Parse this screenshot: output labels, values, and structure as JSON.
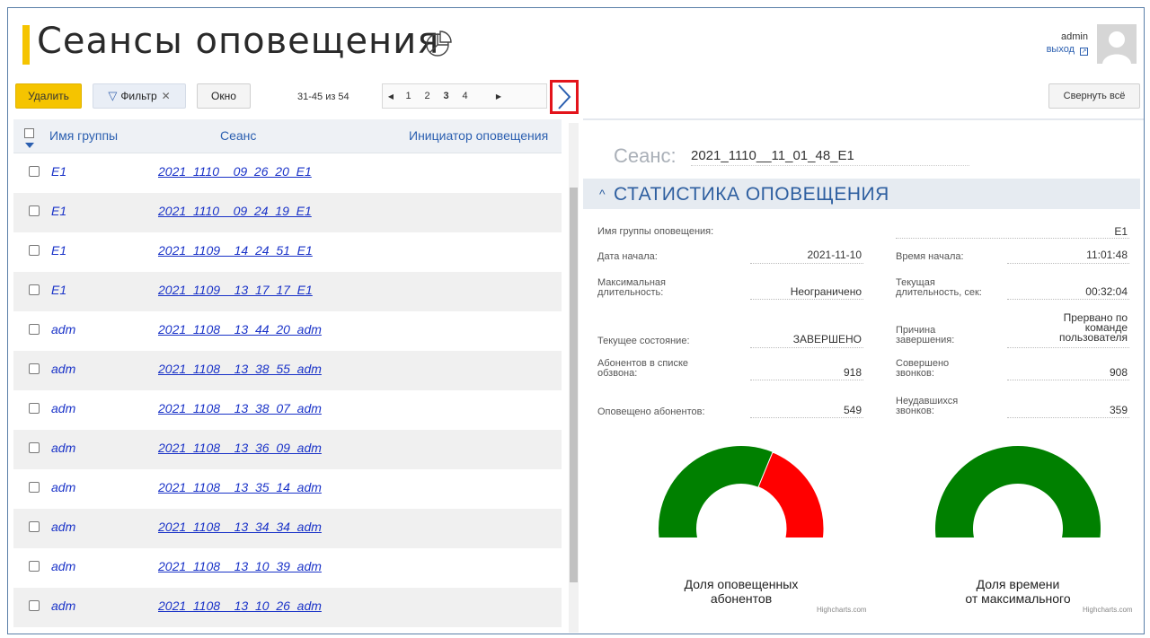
{
  "header": {
    "title": "Сеансы оповещения",
    "user_name": "admin",
    "logout_label": "выход",
    "icons": {
      "chart": "pie-chart-icon",
      "logout": "logout-icon",
      "avatar": "avatar-icon"
    }
  },
  "toolbar": {
    "delete_label": "Удалить",
    "filter_label": "Фильтр",
    "window_label": "Окно",
    "range_label": "31-45 из 54",
    "pages": [
      "1",
      "2",
      "3",
      "4"
    ],
    "current_page": "3",
    "collapse_all_label": "Свернуть всё"
  },
  "grid": {
    "columns": [
      "Имя группы",
      "Сеанс",
      "Инициатор оповещения"
    ],
    "rows": [
      {
        "group": "E1",
        "session": "2021_1110__09_26_20_E1",
        "initiator": ""
      },
      {
        "group": "E1",
        "session": "2021_1110__09_24_19_E1",
        "initiator": ""
      },
      {
        "group": "E1",
        "session": "2021_1109__14_24_51_E1",
        "initiator": ""
      },
      {
        "group": "E1",
        "session": "2021_1109__13_17_17_E1",
        "initiator": ""
      },
      {
        "group": "adm",
        "session": "2021_1108__13_44_20_adm",
        "initiator": ""
      },
      {
        "group": "adm",
        "session": "2021_1108__13_38_55_adm",
        "initiator": ""
      },
      {
        "group": "adm",
        "session": "2021_1108__13_38_07_adm",
        "initiator": ""
      },
      {
        "group": "adm",
        "session": "2021_1108__13_36_09_adm",
        "initiator": ""
      },
      {
        "group": "adm",
        "session": "2021_1108__13_35_14_adm",
        "initiator": ""
      },
      {
        "group": "adm",
        "session": "2021_1108__13_34_34_adm",
        "initiator": ""
      },
      {
        "group": "adm",
        "session": "2021_1108__13_10_39_adm",
        "initiator": ""
      },
      {
        "group": "adm",
        "session": "2021_1108__13_10_26_adm",
        "initiator": ""
      }
    ]
  },
  "detail": {
    "session_label": "Сеанс:",
    "session_value": "2021_1110__11_01_48_E1",
    "stats_title": "СТАТИСТИКА ОПОВЕЩЕНИЯ",
    "group_label": "Имя группы оповещения:",
    "group_value": "E1",
    "start_date_label": "Дата начала:",
    "start_date_value": "2021-11-10",
    "start_time_label": "Время начала:",
    "start_time_value": "11:01:48",
    "max_dur_label1": "Максимальная",
    "max_dur_label2": "длительность:",
    "max_dur_value": "Неограничено",
    "cur_dur_label1": "Текущая",
    "cur_dur_label2": "длительность, сек:",
    "cur_dur_value": "00:32:04",
    "state_label": "Текущее состояние:",
    "state_value": "ЗАВЕРШЕНО",
    "reason_label1": "Причина",
    "reason_label2": "завершения:",
    "reason_value1": "Прервано по",
    "reason_value2": "команде",
    "reason_value3": "пользователя",
    "subs_label1": "Абонентов в списке",
    "subs_label2": "обзвона:",
    "subs_value": "918",
    "calls_label1": "Совершено",
    "calls_label2": "звонков:",
    "calls_value": "908",
    "notified_label": "Оповещено абонентов:",
    "notified_value": "549",
    "failed_label1": "Неудавшихся",
    "failed_label2": "звонков:",
    "failed_value": "359"
  },
  "gauges": [
    {
      "label1": "Доля оповещенных",
      "label2": "абонентов",
      "credit": "Highcharts.com",
      "fraction": 0.598,
      "colors": {
        "value": "#008000",
        "rest": "#ff0000"
      }
    },
    {
      "label1": "Доля времени",
      "label2": "от максимального",
      "credit": "Highcharts.com",
      "fraction": 1.0,
      "colors": {
        "value": "#008000",
        "rest": "#ff0000"
      }
    }
  ],
  "colors": {
    "accent": "#f5c400",
    "link": "#1a33c8",
    "highlight_box": "#e3141b",
    "section_title": "#2e5fa0"
  }
}
